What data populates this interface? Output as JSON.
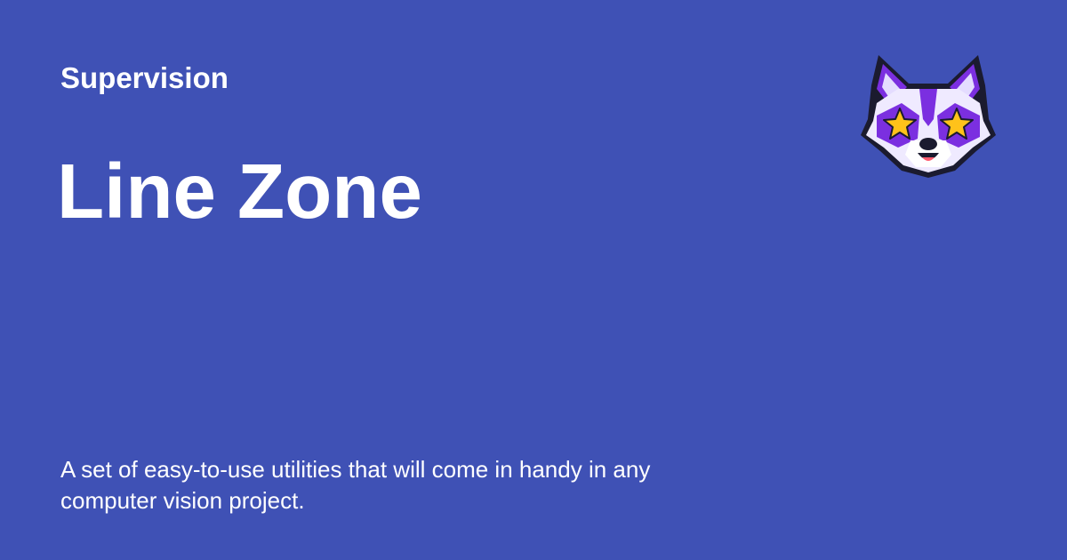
{
  "header": {
    "site_name": "Supervision"
  },
  "page": {
    "title": "Line Zone",
    "description": "A set of easy-to-use utilities that will come in handy in any computer vision project."
  },
  "logo": {
    "icon": "fox-mascot-icon"
  },
  "colors": {
    "background": "#3f51b5",
    "text": "#ffffff",
    "logo_purple": "#7b2fe0",
    "logo_light": "#e4dcff",
    "logo_star": "#ffc21a",
    "logo_outline": "#1b1b2f"
  }
}
